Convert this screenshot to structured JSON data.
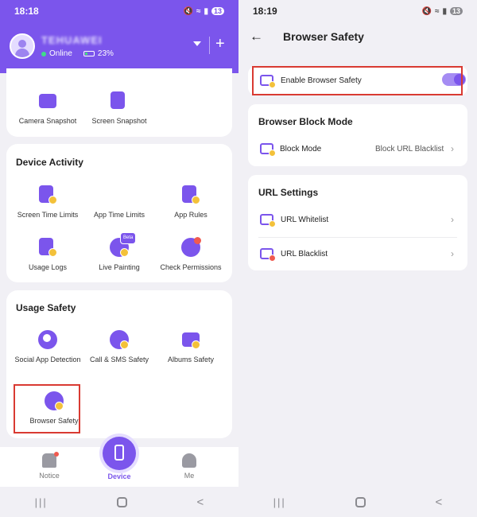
{
  "left": {
    "status": {
      "time": "18:18",
      "battery": "13"
    },
    "header": {
      "device_name": "TEHUAWEI",
      "online": "Online",
      "battery_level": "23%"
    },
    "snapshot": [
      {
        "label": "Camera Snapshot",
        "icon": "camera-snapshot-icon"
      },
      {
        "label": "Screen Snapshot",
        "icon": "screen-snapshot-icon"
      }
    ],
    "device_activity": {
      "title": "Device Activity",
      "items": [
        {
          "label": "Screen Time Limits"
        },
        {
          "label": "App Time Limits"
        },
        {
          "label": "App Rules"
        },
        {
          "label": "Usage Logs"
        },
        {
          "label": "Live Painting",
          "badge": "Beta"
        },
        {
          "label": "Check Permissions"
        }
      ]
    },
    "usage_safety": {
      "title": "Usage Safety",
      "items": [
        {
          "label": "Social App Detection"
        },
        {
          "label": "Call & SMS Safety"
        },
        {
          "label": "Albums Safety"
        },
        {
          "label": "Browser Safety"
        }
      ]
    },
    "bottom_nav": {
      "notice": "Notice",
      "device": "Device",
      "me": "Me"
    }
  },
  "right": {
    "status": {
      "time": "18:19",
      "battery": "13"
    },
    "title": "Browser Safety",
    "enable_label": "Enable Browser Safety",
    "enable_on": true,
    "block_mode": {
      "section": "Browser Block Mode",
      "label": "Block Mode",
      "value": "Block URL Blacklist"
    },
    "url_settings": {
      "section": "URL Settings",
      "whitelist": "URL Whitelist",
      "blacklist": "URL Blacklist"
    }
  },
  "colors": {
    "accent": "#7b55ec",
    "highlight": "#d93a32",
    "badge": "#f3c13a"
  }
}
